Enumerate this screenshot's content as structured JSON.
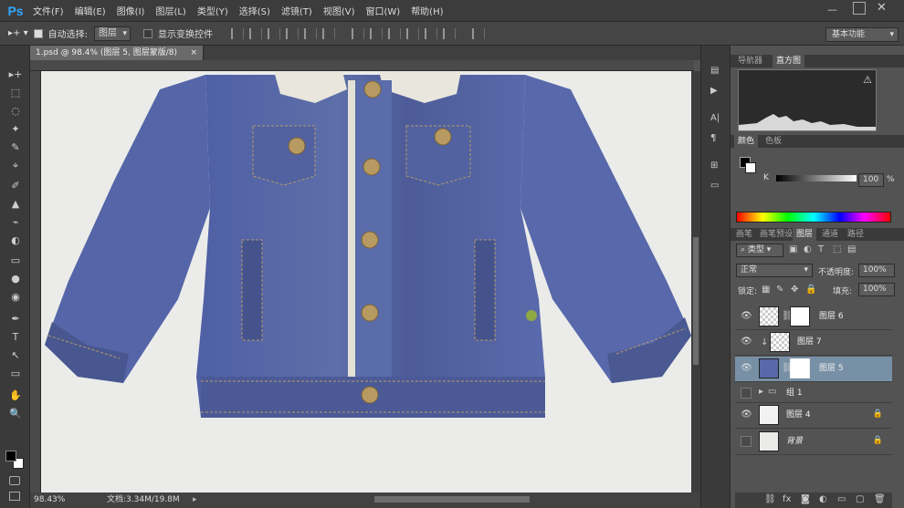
{
  "app": {
    "logo": "Ps"
  },
  "menu": [
    "文件(F)",
    "编辑(E)",
    "图像(I)",
    "图层(L)",
    "类型(Y)",
    "选择(S)",
    "滤镜(T)",
    "视图(V)",
    "窗口(W)",
    "帮助(H)"
  ],
  "options_bar": {
    "auto_select_label": "自动选择:",
    "auto_select_value": "图层",
    "show_transform_label": "显示变换控件",
    "workspace": "基本功能"
  },
  "document": {
    "tab_title": "1.psd @ 98.4% (图层 5, 图层蒙版/8)",
    "tab_close": "×",
    "zoom": "98.43%",
    "doc_size": "文档:3.34M/19.8M"
  },
  "tools": [
    "▸+",
    "⬚",
    "◌",
    "✦",
    "✎",
    "⌖",
    "✐",
    "▲",
    "⌁",
    "◐",
    "▭",
    "●",
    "◉",
    "✒",
    "T",
    "↖",
    "▭",
    "✋",
    "🔍"
  ],
  "panels": {
    "histogram_tabs": [
      "导航器",
      "直方图"
    ],
    "histogram_warning": "⚠",
    "color_tabs": [
      "颜色",
      "色板"
    ],
    "color_channel": "K",
    "color_value": "100",
    "color_unit": "%",
    "layer_tabs": [
      "画笔",
      "画笔预设",
      "图层",
      "通道",
      "路径"
    ],
    "filter_type": "类型",
    "blend_mode": "正常",
    "opacity_label": "不透明度:",
    "opacity_value": "100%",
    "lock_label": "锁定:",
    "fill_label": "填充:",
    "fill_value": "100%",
    "layers": [
      {
        "name": "图层 6",
        "visible": true,
        "selected": false
      },
      {
        "name": "图层 7",
        "visible": true,
        "selected": false
      },
      {
        "name": "图层 5",
        "visible": true,
        "selected": true
      },
      {
        "name": "组 1",
        "visible": false,
        "selected": false
      },
      {
        "name": "图层 4",
        "visible": true,
        "selected": false
      },
      {
        "name": "背景",
        "visible": false,
        "selected": false
      }
    ],
    "bottom_icons": [
      "link-icon",
      "fx-icon",
      "mask-icon",
      "adjustment-icon",
      "folder-icon",
      "new-layer-icon",
      "trash-icon"
    ],
    "fx_label": "fx"
  },
  "colors": {
    "accent": "#31a8ff",
    "selected_layer": "#7790a6",
    "canvas_bg": "#ebecea",
    "denim": "#4a5a9a"
  }
}
